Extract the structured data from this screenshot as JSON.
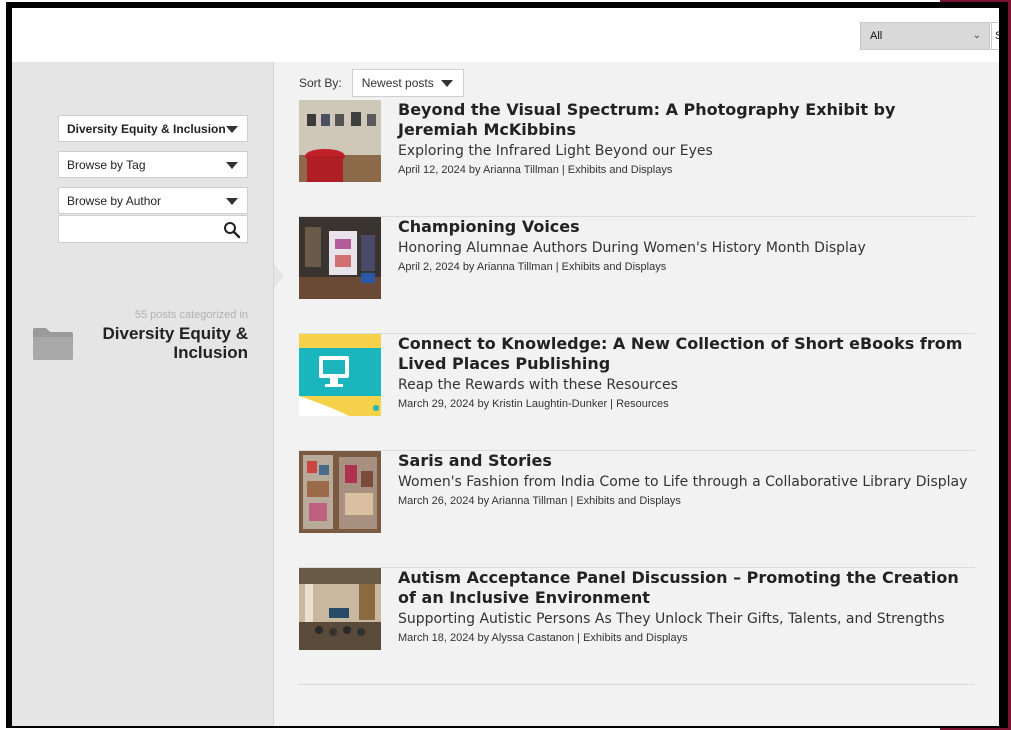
{
  "filter": {
    "selected": "All",
    "extra_label": "S"
  },
  "sidebar": {
    "category_select": "Diversity Equity & Inclusion",
    "tag_select": "Browse by Tag",
    "author_select": "Browse by Author",
    "search": {
      "value": "",
      "placeholder": ""
    },
    "category_count_text": "55 posts categorized in",
    "category_name": "Diversity Equity & Inclusion"
  },
  "sort": {
    "label": "Sort By:",
    "selected": "Newest posts"
  },
  "posts": [
    {
      "title": "Beyond the Visual Spectrum: A Photography Exhibit by Jeremiah McKibbins",
      "subtitle": "Exploring the Infrared Light Beyond our Eyes",
      "meta": "April 12, 2024 by Arianna Tillman | Exhibits and Displays"
    },
    {
      "title": "Championing Voices",
      "subtitle": "Honoring Alumnae Authors During Women's History Month Display",
      "meta": "April 2, 2024 by Arianna Tillman | Exhibits and Displays"
    },
    {
      "title": "Connect to Knowledge: A New Collection of Short eBooks from Lived Places Publishing",
      "subtitle": "Reap the Rewards with these Resources",
      "meta": "March 29, 2024 by Kristin Laughtin-Dunker | Resources"
    },
    {
      "title": "Saris and Stories",
      "subtitle": "Women's Fashion from India Come to Life through a Collaborative Library Display",
      "meta": "March 26, 2024 by Arianna Tillman | Exhibits and Displays"
    },
    {
      "title": "Autism Acceptance Panel Discussion – Promoting the Creation of an Inclusive Environment",
      "subtitle": "Supporting Autistic Persons As They Unlock Their Gifts, Talents, and Strengths",
      "meta": "March 18, 2024 by Alyssa Castanon | Exhibits and Displays"
    }
  ],
  "colors": {
    "accent": "#7a1230",
    "sidebar_bg": "#e5e5e5",
    "content_bg": "#f2f2f2"
  }
}
